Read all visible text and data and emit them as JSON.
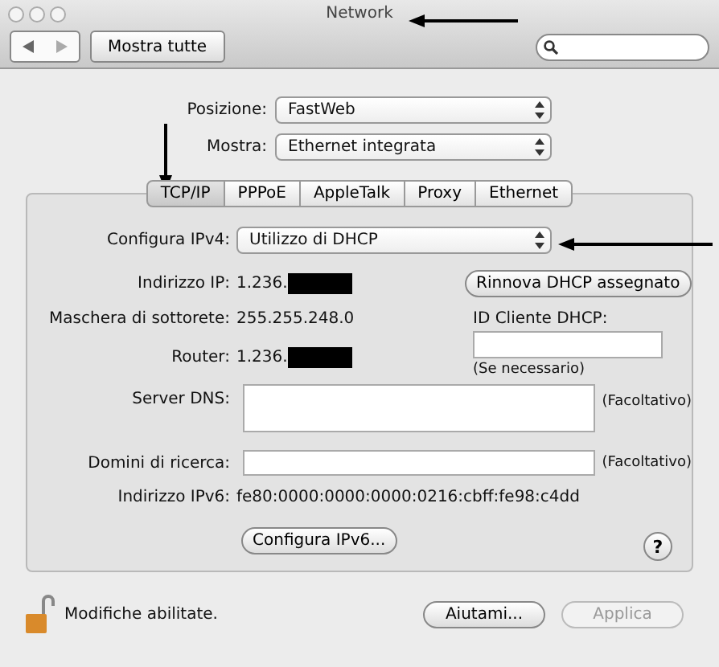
{
  "window": {
    "title": "Network"
  },
  "toolbar": {
    "show_all": "Mostra tutte"
  },
  "location": {
    "label": "Posizione:",
    "value": "FastWeb"
  },
  "show": {
    "label": "Mostra:",
    "value": "Ethernet integrata"
  },
  "tabs": [
    {
      "label": "TCP/IP",
      "selected": true
    },
    {
      "label": "PPPoE",
      "selected": false
    },
    {
      "label": "AppleTalk",
      "selected": false
    },
    {
      "label": "Proxy",
      "selected": false
    },
    {
      "label": "Ethernet",
      "selected": false
    }
  ],
  "configure_ipv4": {
    "label": "Configura IPv4:",
    "value": "Utilizzo di DHCP"
  },
  "ip_address": {
    "label": "Indirizzo IP:",
    "value": "1.236."
  },
  "renew_button": "Rinnova DHCP assegnato",
  "subnet_mask": {
    "label": "Maschera di sottorete:",
    "value": "255.255.248.0"
  },
  "dhcp_client_id": {
    "label": "ID Cliente DHCP:",
    "hint": "(Se necessario)"
  },
  "router": {
    "label": "Router:",
    "value": "1.236."
  },
  "dns_servers": {
    "label": "Server DNS:",
    "note": "(Facoltativo)"
  },
  "search_domains": {
    "label": "Domini di ricerca:",
    "note": "(Facoltativo)"
  },
  "ipv6_address": {
    "label": "Indirizzo IPv6:",
    "value": "fe80:0000:0000:0000:0216:cbff:fe98:c4dd"
  },
  "configure_ipv6_button": "Configura IPv6...",
  "help_button": "?",
  "lock": {
    "text": "Modifiche abilitate.",
    "locked": false
  },
  "buttons": [
    {
      "label": "Aiutami...",
      "disabled": false
    },
    {
      "label": "Applica",
      "disabled": true
    }
  ]
}
